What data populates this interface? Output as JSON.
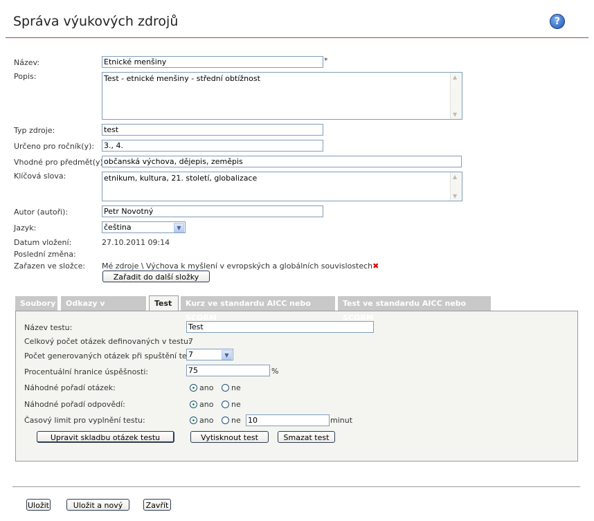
{
  "header": {
    "title": "Správa výukových zdrojů",
    "help_icon": "help-icon"
  },
  "form": {
    "name_label": "Název:",
    "name_value": "Etnické menšiny",
    "required_mark": "*",
    "desc_label": "Popis:",
    "desc_value": "Test - etnické menšiny - střední obtížnost",
    "type_label": "Typ zdroje:",
    "type_value": "test",
    "grade_label": "Určeno pro ročník(y):",
    "grade_value": "3., 4.",
    "subject_label": "Vhodné pro předmět(y):",
    "subject_value": "občanská výchova, dějepis, zeměpis",
    "keywords_label": "Klíčová slova:",
    "keywords_value": "etnikum, kultura, 21. století, globalizace",
    "author_label": "Autor (autoři):",
    "author_value": "Petr Novotný",
    "lang_label": "Jazyk:",
    "lang_value": "čeština",
    "date_label": "Datum vložení:",
    "date_value": "27.10.2011 09:14",
    "modified_label": "Poslední změna:",
    "folder_label": "Zařazen ve složce:",
    "folder_value": "Mé zdroje \\ Výchova k myšlení v evropských a globálních souvislostech",
    "folder_button": "Zařadit do další složky"
  },
  "tabs": [
    {
      "label": "Soubory"
    },
    {
      "label": "Odkazy v internetu"
    },
    {
      "label": "Test",
      "active": true
    },
    {
      "label": "Kurz ve standardu AICC nebo SCORM"
    },
    {
      "label": "Test ve standardu AICC nebo SCORM"
    }
  ],
  "test": {
    "name_label": "Název testu:",
    "name_value": "Test",
    "total_label": "Celkový počet otázek definovaných v testu:",
    "total_value": "7",
    "generated_label": "Počet generovaných otázek při spuštění testu:",
    "generated_value": "7",
    "percent_label": "Procentuální hranice úspěšnosti:",
    "percent_value": "75",
    "percent_unit": "%",
    "random_q_label": "Náhodné pořadí otázek:",
    "random_a_label": "Náhodné pořadí odpovědí:",
    "time_label": "Časový limit pro vyplnění testu:",
    "time_value": "10",
    "time_unit": "minut",
    "yes": "ano",
    "no": "ne",
    "random_q": "ano",
    "random_a": "ano",
    "time_limit": "ano",
    "edit_button": "Upravit skladbu otázek testu",
    "print_button": "Vytisknout test",
    "delete_button": "Smazat test"
  },
  "footer": {
    "save": "Uložit",
    "save_new": "Uložit a nový",
    "close": "Zavřít"
  }
}
